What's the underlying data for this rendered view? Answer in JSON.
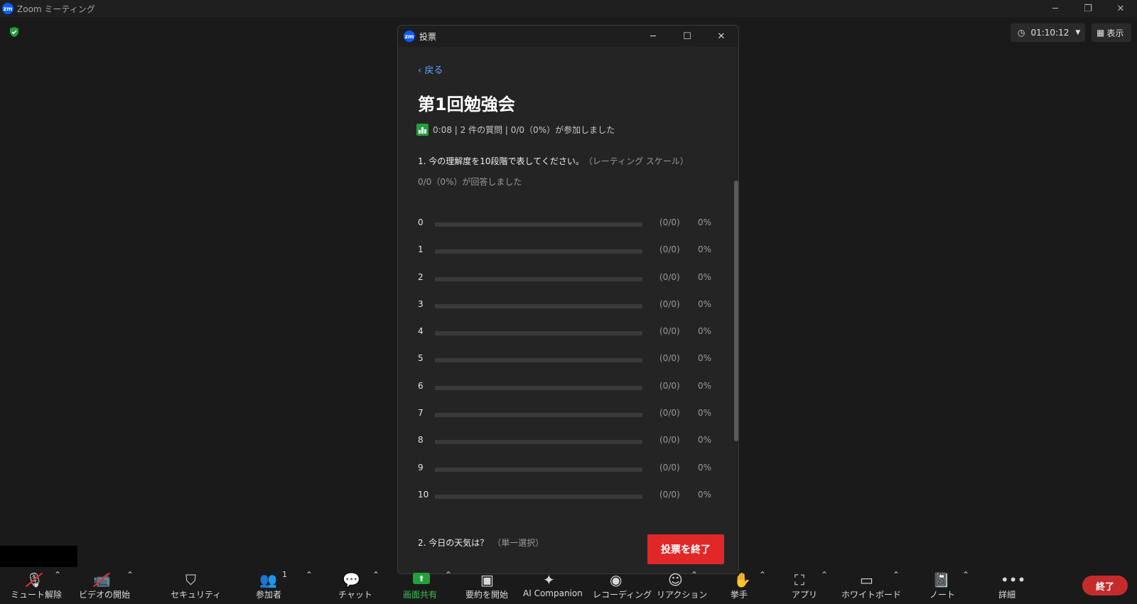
{
  "app": {
    "title": "Zoom ミーティング",
    "logo_text": "zm",
    "window_controls": [
      "minimize-icon",
      "restore-icon",
      "close-icon"
    ]
  },
  "header": {
    "timer": "01:10:12",
    "view_label": "表示"
  },
  "dialog": {
    "title": "投票",
    "logo_text": "zm",
    "back_label": "戻る",
    "poll_title": "第1回勉強会",
    "meta": "0:08 | 2 件の質問 | 0/0（0%）が参加しました",
    "question1": {
      "title": "1. 今の理解度を10段階で表してください。",
      "type": "（レーティング スケール）",
      "answered": "0/0（0%）が回答しました",
      "options": [
        {
          "label": "0",
          "count": "(0/0)",
          "percent": "0%",
          "value": 0
        },
        {
          "label": "1",
          "count": "(0/0)",
          "percent": "0%",
          "value": 0
        },
        {
          "label": "2",
          "count": "(0/0)",
          "percent": "0%",
          "value": 0
        },
        {
          "label": "3",
          "count": "(0/0)",
          "percent": "0%",
          "value": 0
        },
        {
          "label": "4",
          "count": "(0/0)",
          "percent": "0%",
          "value": 0
        },
        {
          "label": "5",
          "count": "(0/0)",
          "percent": "0%",
          "value": 0
        },
        {
          "label": "6",
          "count": "(0/0)",
          "percent": "0%",
          "value": 0
        },
        {
          "label": "7",
          "count": "(0/0)",
          "percent": "0%",
          "value": 0
        },
        {
          "label": "8",
          "count": "(0/0)",
          "percent": "0%",
          "value": 0
        },
        {
          "label": "9",
          "count": "(0/0)",
          "percent": "0%",
          "value": 0
        },
        {
          "label": "10",
          "count": "(0/0)",
          "percent": "0%",
          "value": 0
        }
      ]
    },
    "question2": {
      "title": "2. 今日の天気は？",
      "type": "（単一選択）"
    },
    "end_poll_label": "投票を終了"
  },
  "toolbar": {
    "unmute": "ミュート解除",
    "start_video": "ビデオの開始",
    "security": "セキュリティ",
    "participants": "参加者",
    "participants_count": "1",
    "chat": "チャット",
    "share_screen": "画面共有",
    "start_summary": "要約を開始",
    "ai_companion": "AI Companion",
    "recording": "レコーディング",
    "reactions": "リアクション",
    "raise_hand": "挙手",
    "apps": "アプリ",
    "whiteboard": "ホワイトボード",
    "notes": "ノート",
    "more": "詳細",
    "end": "終了"
  },
  "colors": {
    "background": "#1a1a1a",
    "accent": "#0b5cff",
    "end_button": "#e02828",
    "share_green": "#22a13b"
  }
}
